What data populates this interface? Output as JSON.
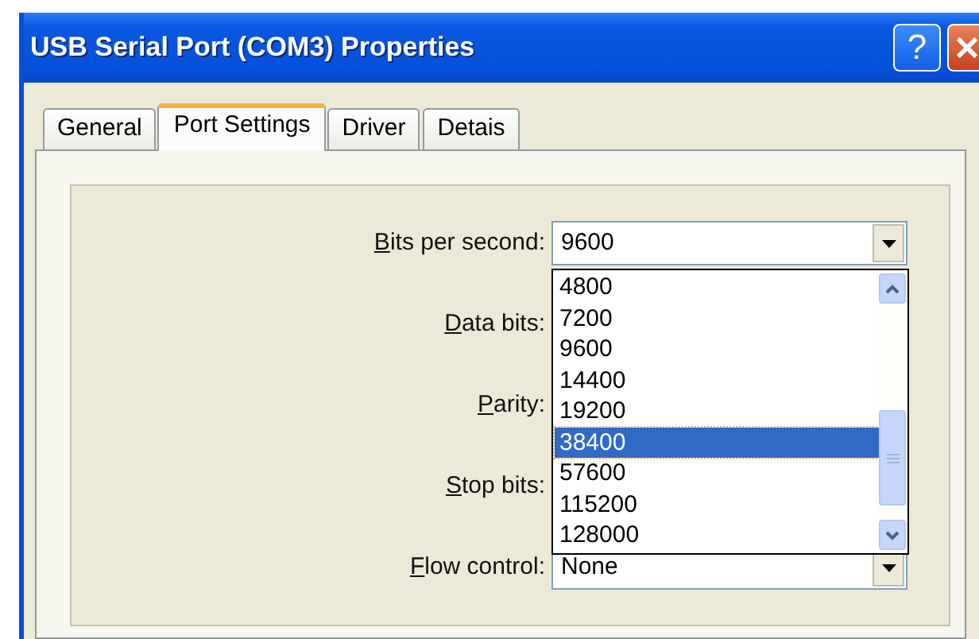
{
  "window": {
    "title": "USB Serial Port (COM3) Properties",
    "title_buttons": [
      {
        "kind": "help",
        "label": "?"
      },
      {
        "kind": "close"
      }
    ]
  },
  "tabs": [
    {
      "label": "General",
      "selected": false
    },
    {
      "label": "Port Settings",
      "selected": true
    },
    {
      "label": "Driver",
      "selected": false
    },
    {
      "label": "Detais",
      "selected": false
    }
  ],
  "fields": [
    {
      "label": "Bits per second:",
      "value": "9600",
      "dropdown": {
        "options": [
          {
            "label": "4800",
            "selected": false
          },
          {
            "label": "7200",
            "selected": false
          },
          {
            "label": "9600",
            "selected": false
          },
          {
            "label": "14400",
            "selected": false
          },
          {
            "label": "19200",
            "selected": false
          },
          {
            "label": "38400",
            "selected": true
          },
          {
            "label": "57600",
            "selected": false
          },
          {
            "label": "115200",
            "selected": false
          },
          {
            "label": "128000",
            "selected": false
          }
        ]
      }
    },
    {
      "label": "Data bits:"
    },
    {
      "label": "Parity:"
    },
    {
      "label": "Stop bits:"
    },
    {
      "label": "Flow control:",
      "value": "None"
    }
  ]
}
